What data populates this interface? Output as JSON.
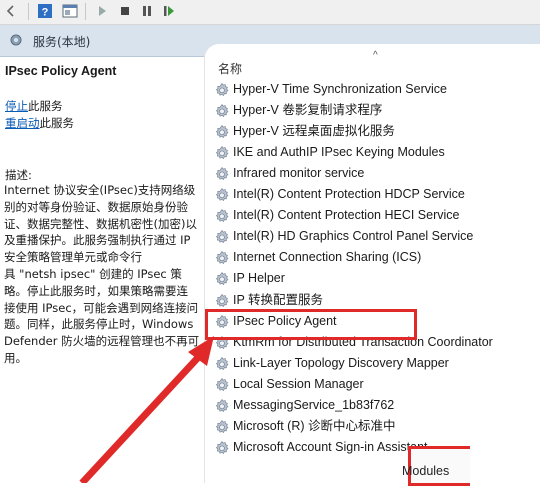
{
  "header": {
    "title": "服务(本地)"
  },
  "left_pane": {
    "service_name": "IPsec Policy Agent",
    "actions": [
      {
        "link": "停止",
        "suffix": "此服务"
      },
      {
        "link": "重启动",
        "suffix": "此服务"
      }
    ],
    "description_label": "描述:",
    "description": "Internet 协议安全(IPsec)支持网络级\n别的对等身份验证、数据原始身份验\n证、数据完整性、数据机密性(加密)以\n及重播保护。此服务强制执行通过 IP\n安全策略管理单元或命令行\n具 \"netsh ipsec\" 创建的 IPsec 策\n略。停止此服务时，如果策略需要连\n接使用 IPsec，可能会遇到网络连接问\n题。同样，此服务停止时，Windows\nDefender 防火墙的远程管理也不再可\n用。"
  },
  "list": {
    "column_name": "名称",
    "sort_indicator": "^",
    "rows": [
      "Hyper-V Time Synchronization Service",
      "Hyper-V 卷影复制请求程序",
      "Hyper-V 远程桌面虚拟化服务",
      "IKE and AuthIP IPsec Keying Modules",
      "Infrared monitor service",
      "Intel(R) Content Protection HDCP Service",
      "Intel(R) Content Protection HECI Service",
      "Intel(R) HD Graphics Control Panel Service",
      "Internet Connection Sharing (ICS)",
      "IP Helper",
      "IP 转换配置服务",
      "IPsec Policy Agent",
      "KtmRm for Distributed Transaction Coordinator",
      "Link-Layer Topology Discovery Mapper",
      "Local Session Manager",
      "MessagingService_1b83f762",
      "Microsoft (R) 诊断中心标准中",
      "Microsoft Account Sign-in Assistant"
    ],
    "selected_index": 11
  },
  "annotation": {
    "bottom_label": "Modules"
  },
  "colors": {
    "highlight_red": "#e02a2a",
    "link_blue": "#0a5bb5",
    "header_band": "#d8e3ee"
  },
  "icons": [
    "back-icon",
    "forward-icon",
    "help-icon",
    "properties-icon",
    "play-icon",
    "stop-icon",
    "pause-icon",
    "resume-icon",
    "gear-icon"
  ]
}
